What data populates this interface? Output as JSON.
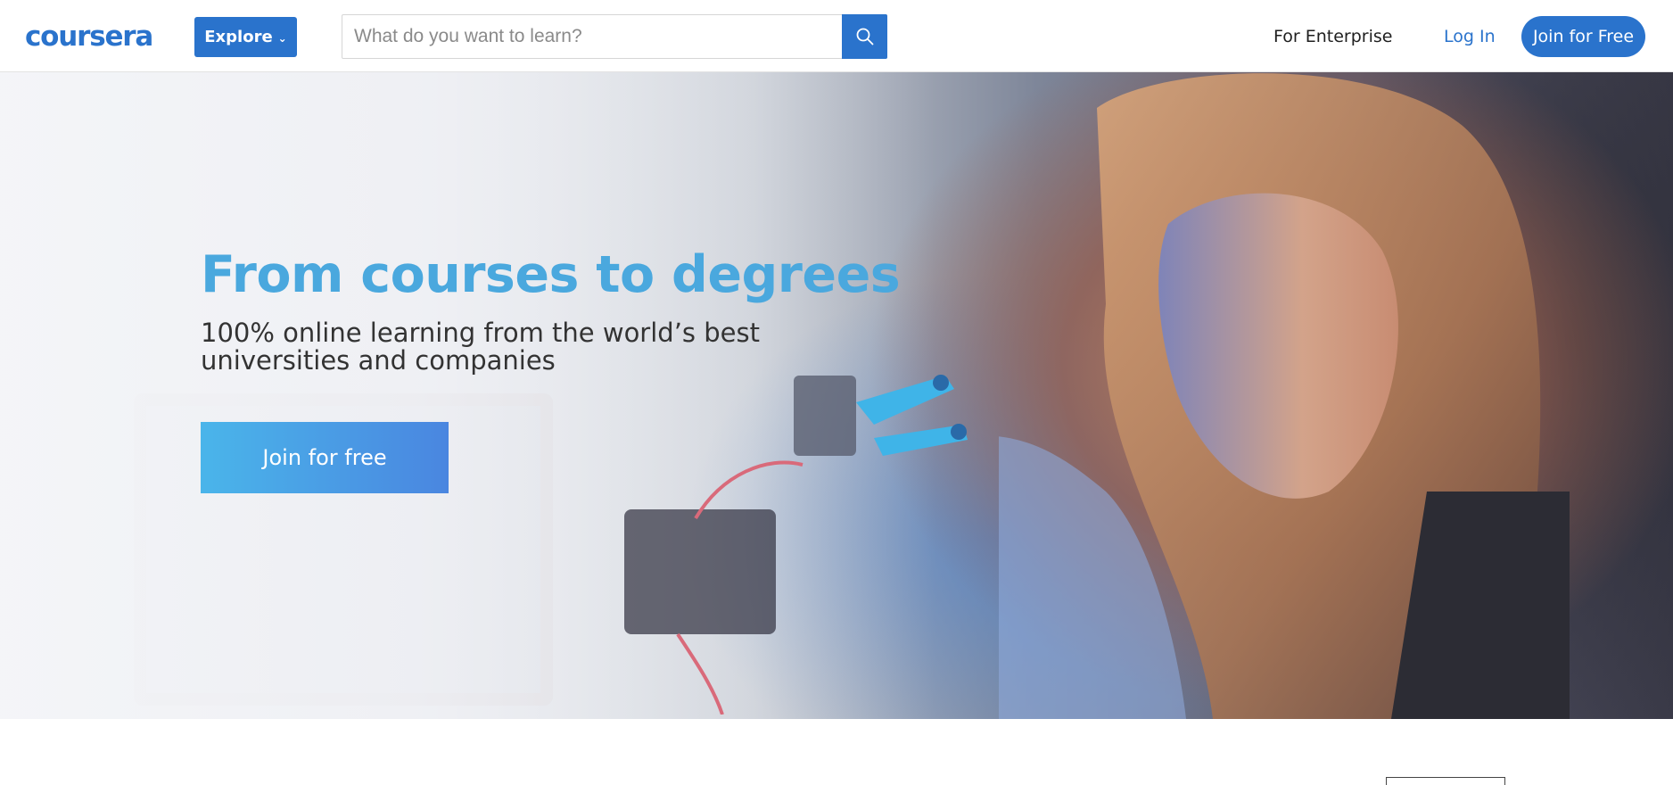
{
  "header": {
    "logo_text": "coursera",
    "explore_label": "Explore",
    "search_placeholder": "What do you want to learn?",
    "for_enterprise_label": "For Enterprise",
    "login_label": "Log In",
    "join_label": "Join for Free"
  },
  "hero": {
    "title": "From courses to degrees",
    "subtitle": "100% online learning from the world’s best universities and companies",
    "cta_label": "Join for free"
  },
  "colors": {
    "brand_blue": "#2a73cc",
    "title_blue": "#4aa8de",
    "cta_gradient_start": "#4ab5ea",
    "cta_gradient_end": "#4a86e0"
  },
  "icons": {
    "search": "search-icon",
    "explore_chevron": "chevron-down-icon"
  }
}
